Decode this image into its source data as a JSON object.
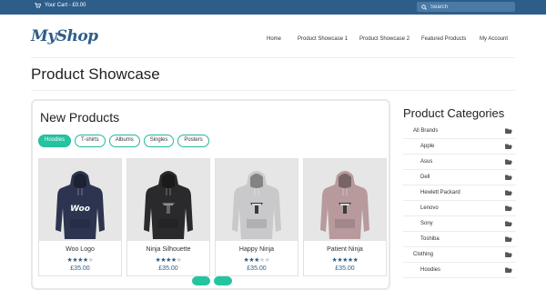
{
  "topbar": {
    "cart_text": "Your Cart - £0.00",
    "search_placeholder": "Search",
    "bar_color": "#2d5e8a"
  },
  "header": {
    "logo": "MyShop",
    "nav": [
      "Home",
      "Product Showcase 1",
      "Product Showcase 2",
      "Featured Products",
      "My Account"
    ]
  },
  "page": {
    "title": "Product Showcase"
  },
  "panel": {
    "title": "New Products",
    "tabs": [
      {
        "label": "Hoodies",
        "active": true
      },
      {
        "label": "T-shirts",
        "active": false
      },
      {
        "label": "Albums",
        "active": false
      },
      {
        "label": "Singles",
        "active": false
      },
      {
        "label": "Posters",
        "active": false
      }
    ],
    "products": [
      {
        "name": "Woo Logo",
        "rating": 4,
        "price": "£35.00",
        "color": "#2d3450",
        "print": "woo"
      },
      {
        "name": "Ninja Silhouette",
        "rating": 4,
        "price": "£35.00",
        "color": "#2a2a2c",
        "print": "ninja"
      },
      {
        "name": "Happy Ninja",
        "rating": 3,
        "price": "£35.00",
        "color": "#c9c9cb",
        "print": "ninja"
      },
      {
        "name": "Patient Ninja",
        "rating": 5,
        "price": "£35.00",
        "color": "#b89a9c",
        "print": "ninja"
      }
    ],
    "accent_color": "#24c4a0"
  },
  "sidebar": {
    "title": "Product Categories",
    "categories": [
      {
        "label": "All Brands",
        "level": "top"
      },
      {
        "label": "Apple",
        "level": "sub"
      },
      {
        "label": "Asus",
        "level": "sub"
      },
      {
        "label": "Dell",
        "level": "sub"
      },
      {
        "label": "Hewlett Packard",
        "level": "sub"
      },
      {
        "label": "Lenovo",
        "level": "sub"
      },
      {
        "label": "Sony",
        "level": "sub"
      },
      {
        "label": "Toshiba",
        "level": "sub"
      },
      {
        "label": "Clothing",
        "level": "top"
      },
      {
        "label": "Hoodies",
        "level": "sub"
      }
    ]
  }
}
